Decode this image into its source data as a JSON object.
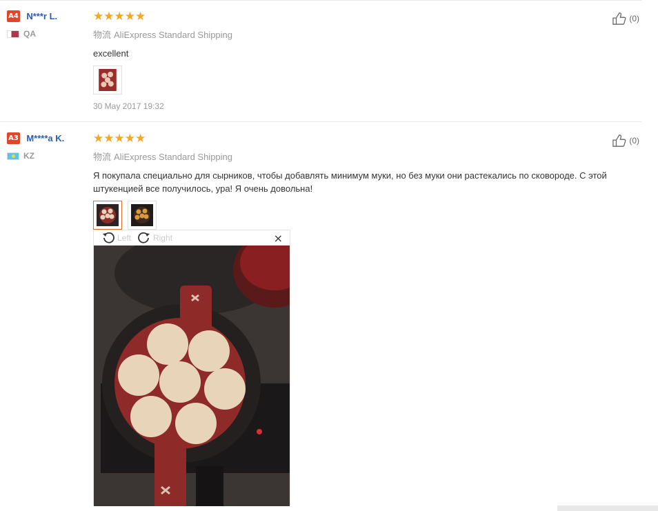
{
  "reviews": [
    {
      "level": "A4",
      "user": "N***r L.",
      "country": "QA",
      "stars": "★★★★★",
      "shipping_label": "物流",
      "shipping": "AliExpress Standard Shipping",
      "text": "excellent",
      "date": "30 May 2017 19:32",
      "helpful_count": "(0)"
    },
    {
      "level": "A3",
      "user": "M****a K.",
      "country": "KZ",
      "stars": "★★★★★",
      "shipping_label": "物流",
      "shipping": "AliExpress Standard Shipping",
      "text": "Я покупала специально для сырников, чтобы добавлять минимум муки, но без муки они растекались по сковороде. С этой штукенцией все получилось, ура! Я очень довольна!",
      "helpful_count": "(0)"
    }
  ],
  "viewer": {
    "rotate_left": "Left",
    "rotate_right": "Right",
    "close": "×"
  },
  "icons": {
    "thumb": "thumb-up-icon",
    "rotate_left": "rotate-left-icon",
    "rotate_right": "rotate-right-icon",
    "close": "close-icon"
  },
  "colors": {
    "level_badge": "#e0462c",
    "user_link": "#2a5db0",
    "stars": "#f5a623",
    "active_thumb": "#e06a2c"
  }
}
